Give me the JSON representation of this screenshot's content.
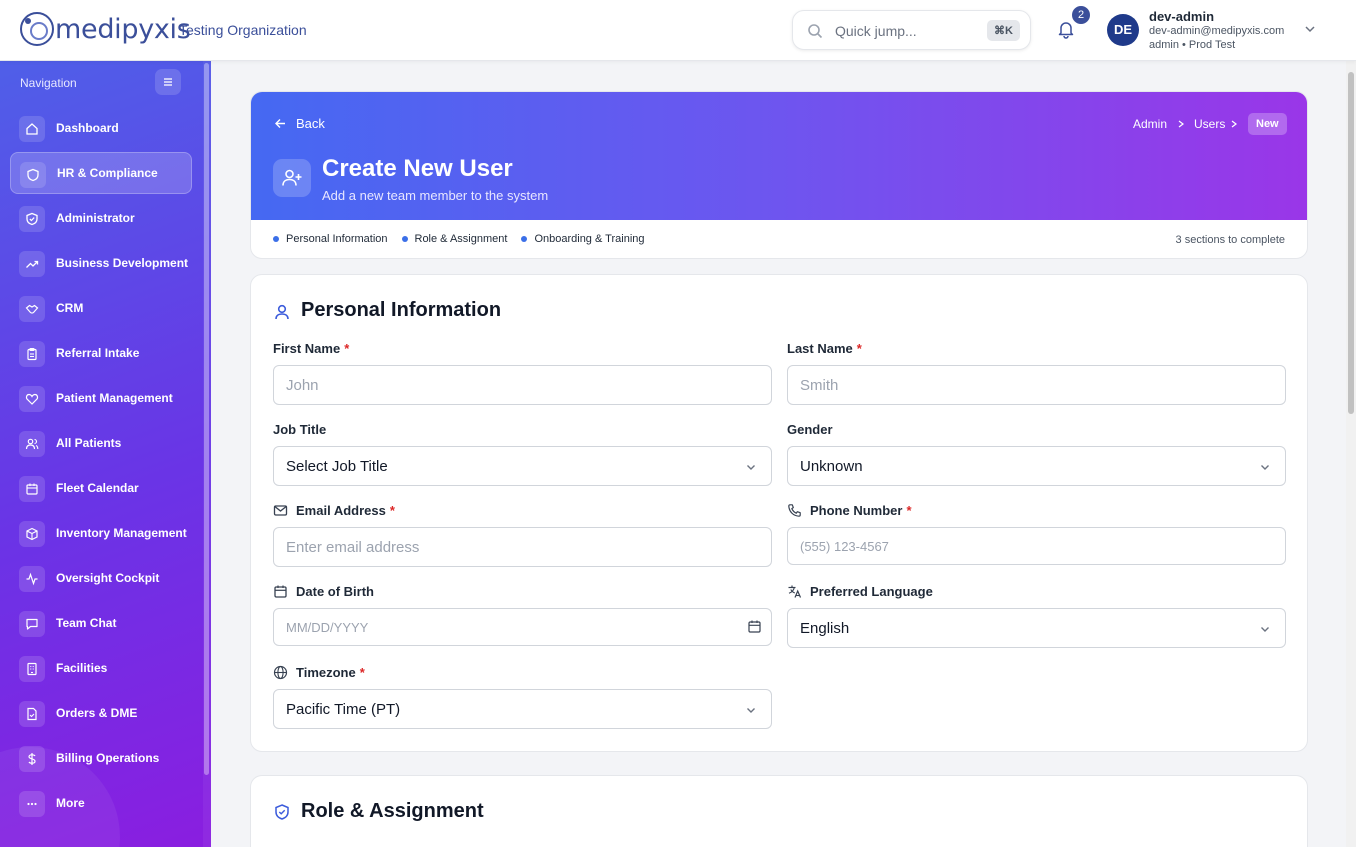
{
  "header": {
    "brand": "medipyxis",
    "org": "Testing Organization",
    "quick_jump_placeholder": "Quick jump...",
    "quick_jump_shortcut": "⌘K",
    "notification_count": "2",
    "user_initials": "DE",
    "user_name": "dev-admin",
    "user_email": "dev-admin@medipyxis.com",
    "user_role": "admin • Prod Test"
  },
  "sidebar": {
    "title": "Navigation",
    "items": [
      {
        "label": "Dashboard",
        "icon": "home-icon"
      },
      {
        "label": "HR & Compliance",
        "icon": "shield-icon",
        "active": true
      },
      {
        "label": "Administrator",
        "icon": "shield-check-icon"
      },
      {
        "label": "Business Development",
        "icon": "trending-up-icon"
      },
      {
        "label": "CRM",
        "icon": "handshake-icon"
      },
      {
        "label": "Referral Intake",
        "icon": "clipboard-icon"
      },
      {
        "label": "Patient Management",
        "icon": "heart-icon"
      },
      {
        "label": "All Patients",
        "icon": "users-icon"
      },
      {
        "label": "Fleet Calendar",
        "icon": "calendar-icon"
      },
      {
        "label": "Inventory Management",
        "icon": "package-icon"
      },
      {
        "label": "Oversight Cockpit",
        "icon": "activity-icon"
      },
      {
        "label": "Team Chat",
        "icon": "message-icon"
      },
      {
        "label": "Facilities",
        "icon": "building-icon"
      },
      {
        "label": "Orders & DME",
        "icon": "file-icon"
      },
      {
        "label": "Billing Operations",
        "icon": "dollar-icon"
      },
      {
        "label": "More",
        "icon": "more-icon"
      }
    ]
  },
  "hero": {
    "back_label": "Back",
    "breadcrumb": [
      "Admin",
      "Users",
      "New"
    ],
    "title": "Create New User",
    "subtitle": "Add a new team member to the system",
    "steps": [
      "Personal Information",
      "Role & Assignment",
      "Onboarding & Training"
    ],
    "steps_status": "3 sections to complete"
  },
  "personal": {
    "title": "Personal Information",
    "first_name_label": "First Name",
    "first_name_placeholder": "John",
    "last_name_label": "Last Name",
    "last_name_placeholder": "Smith",
    "job_title_label": "Job Title",
    "job_title_value": "Select Job Title",
    "gender_label": "Gender",
    "gender_value": "Unknown",
    "email_label": "Email Address",
    "email_placeholder": "Enter email address",
    "phone_label": "Phone Number",
    "phone_placeholder": "(555) 123-4567",
    "dob_label": "Date of Birth",
    "dob_placeholder": "MM/DD/YYYY",
    "language_label": "Preferred Language",
    "language_value": "English",
    "timezone_label": "Timezone",
    "timezone_value": "Pacific Time (PT)",
    "required_mark": "*"
  },
  "role": {
    "title": "Role & Assignment"
  }
}
